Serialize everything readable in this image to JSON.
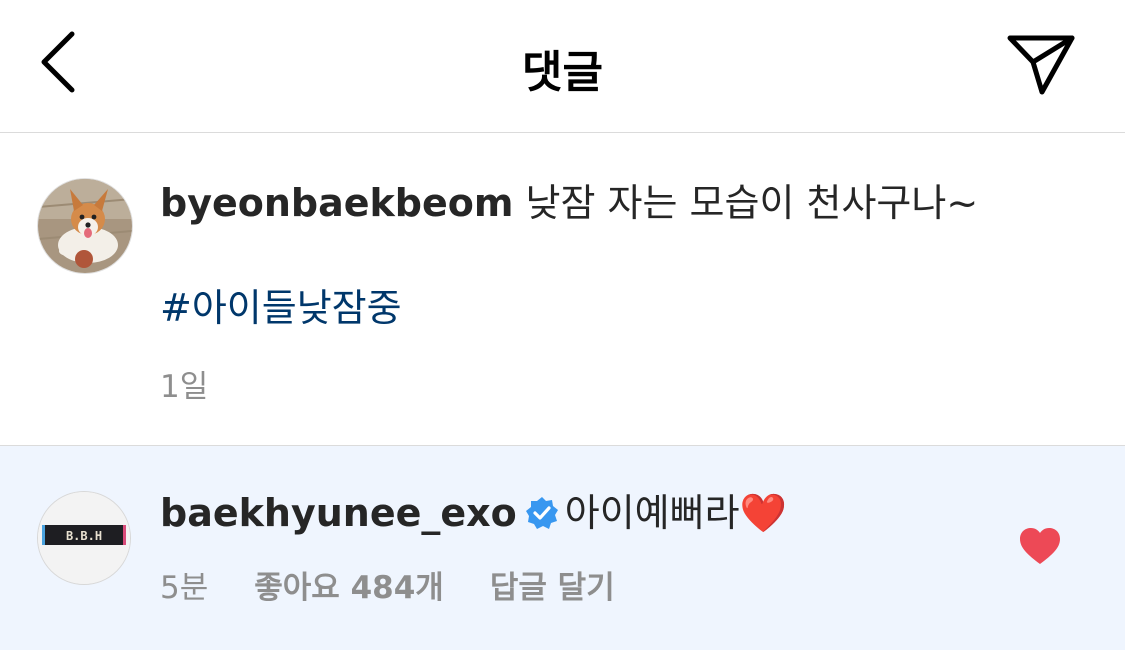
{
  "header": {
    "title": "댓글",
    "back_icon": "chevron-left-icon",
    "share_icon": "paper-plane-icon"
  },
  "caption": {
    "username": "byeonbaekbeom",
    "text": " 낮잠 자는 모습이 천사구나~",
    "hashtag": "#아이들낮잠중",
    "time": "1일",
    "avatar": "corgi-dog-avatar"
  },
  "comment": {
    "username": "baekhyunee_exo",
    "verified": true,
    "text": "아이예뻐라❤️",
    "time": "5분",
    "likes": "좋아요 484개",
    "reply": "답글 달기",
    "avatar_text": "B.B.H",
    "liked": true,
    "like_color": "#ed4956"
  },
  "colors": {
    "hashtag": "#00376b",
    "meta": "#8e8e8e",
    "comment_bg": "#eff5fe",
    "verified": "#3897f0"
  }
}
